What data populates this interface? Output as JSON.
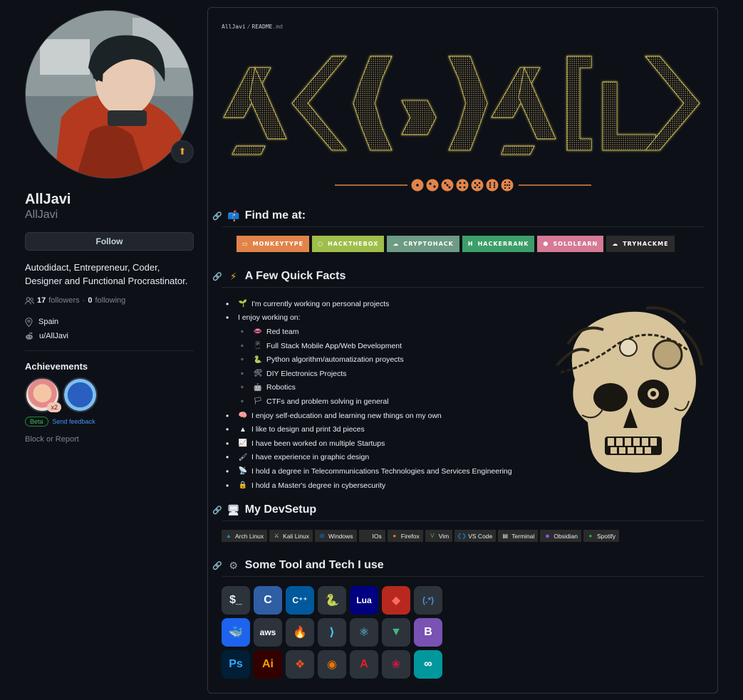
{
  "profile": {
    "fullname": "AllJavi",
    "username": "AllJavi",
    "follow_label": "Follow",
    "bio": "Autodidact, Entrepreneur, Coder, Designer and Functional Procrastinator.",
    "followers_count": "17",
    "followers_label": "followers",
    "dot": "·",
    "following_count": "0",
    "following_label": "following",
    "location": "Spain",
    "reddit": "u/AllJavi",
    "achievements_title": "Achievements",
    "badge_count": "x2",
    "beta_label": "Beta",
    "feedback_label": "Send feedback",
    "report_label": "Block or Report"
  },
  "readme": {
    "breadcrumb_user": "AllJavi",
    "breadcrumb_sep": "/",
    "breadcrumb_file": "README",
    "breadcrumb_ext": ".md",
    "find_title": "Find me at:",
    "facts_title": "A Few Quick Facts",
    "devsetup_title": "My DevSetup",
    "tools_title": "Some Tool and Tech I use"
  },
  "social": [
    {
      "label": "MONKEYTYPE",
      "color": "#e2844a",
      "icon": "▭"
    },
    {
      "label": "HACKTHEBOX",
      "color": "#9fbe4a",
      "icon": "⬡"
    },
    {
      "label": "CRYPTOHACK",
      "color": "#6d9b84",
      "icon": "☁"
    },
    {
      "label": "HACKERRANK",
      "color": "#3d9e6a",
      "icon": "H"
    },
    {
      "label": "SOLOLEARN",
      "color": "#d67a95",
      "icon": "⬢"
    },
    {
      "label": "TRYHACKME",
      "color": "#2b2b2b",
      "icon": "☁"
    }
  ],
  "facts": [
    {
      "level": 1,
      "icon": "🌱",
      "text": "I'm currently working on personal projects"
    },
    {
      "level": 1,
      "icon": "",
      "text": "I enjoy working on:"
    },
    {
      "level": 2,
      "icon": "👄",
      "text": "Red team"
    },
    {
      "level": 2,
      "icon": "📱",
      "text": "Full Stack Mobile App/Web Development"
    },
    {
      "level": 2,
      "icon": "🐍",
      "text": "Python algorithm/automatization proyects"
    },
    {
      "level": 2,
      "icon": "🛠",
      "text": "DIY Electronics Projects"
    },
    {
      "level": 2,
      "icon": "🤖",
      "text": "Robotics"
    },
    {
      "level": 2,
      "icon": "🏳",
      "text": "CTFs and problem solving in general"
    },
    {
      "level": 1,
      "icon": "🧠",
      "text": "I enjoy self-education and learning new things on my own"
    },
    {
      "level": 1,
      "icon": "▲",
      "text": "I like to design and print 3d pieces"
    },
    {
      "level": 1,
      "icon": "📈",
      "text": "I have been worked on multiple Startups"
    },
    {
      "level": 1,
      "icon": "🖌",
      "text": "I have experience in graphic design"
    },
    {
      "level": 1,
      "icon": "📡",
      "text": "I hold a degree in Telecommunications Technologies and Services Engineering"
    },
    {
      "level": 1,
      "icon": "🔒",
      "text": "I hold a Master's degree in cybersecurity"
    }
  ],
  "devsetup": [
    {
      "label": "Arch Linux",
      "icon": "▲",
      "color": "#1793d1"
    },
    {
      "label": "Kali Linux",
      "icon": "⚔",
      "color": "#cfcfcf"
    },
    {
      "label": "Windows",
      "icon": "⊞",
      "color": "#0078d6"
    },
    {
      "label": "IOs",
      "icon": "",
      "color": "#ffffff"
    },
    {
      "label": "Firefox",
      "icon": "●",
      "color": "#ff7139"
    },
    {
      "label": "Vim",
      "icon": "V",
      "color": "#37b34a"
    },
    {
      "label": "VS Code",
      "icon": "❮❯",
      "color": "#0078d4"
    },
    {
      "label": "Terminal",
      "icon": "▤",
      "color": "#e6edf3"
    },
    {
      "label": "Obsidian",
      "icon": "◆",
      "color": "#7c5bd9"
    },
    {
      "label": "Spotify",
      "icon": "●",
      "color": "#1db954"
    }
  ],
  "tools": [
    {
      "name": "bash-icon",
      "glyph": "$_",
      "bg": "#2d333b",
      "fg": "#e6edf3"
    },
    {
      "name": "c-icon",
      "glyph": "C",
      "bg": "#2f5ea3",
      "fg": "#ffffff"
    },
    {
      "name": "cpp-icon",
      "glyph": "C⁺⁺",
      "bg": "#00599c",
      "fg": "#ffffff"
    },
    {
      "name": "python-icon",
      "glyph": "🐍",
      "bg": "#2d333b",
      "fg": "#ffd43b"
    },
    {
      "name": "lua-icon",
      "glyph": "Lua",
      "bg": "#000080",
      "fg": "#ffffff"
    },
    {
      "name": "ruby-icon",
      "glyph": "◆",
      "bg": "#b8281e",
      "fg": "#ff6b5b"
    },
    {
      "name": "regex-icon",
      "glyph": "(.*)",
      "bg": "#2d333b",
      "fg": "#4a90d9"
    },
    {
      "name": "docker-icon",
      "glyph": "🐳",
      "bg": "#1d63ed",
      "fg": "#ffffff"
    },
    {
      "name": "aws-icon",
      "glyph": "aws",
      "bg": "#2d333b",
      "fg": "#ffffff"
    },
    {
      "name": "firebase-icon",
      "glyph": "🔥",
      "bg": "#2d333b",
      "fg": "#ffca28"
    },
    {
      "name": "flutter-icon",
      "glyph": "⟩",
      "bg": "#2d333b",
      "fg": "#44d1fd"
    },
    {
      "name": "react-icon",
      "glyph": "⚛",
      "bg": "#2d333b",
      "fg": "#61dafb"
    },
    {
      "name": "vue-icon",
      "glyph": "▼",
      "bg": "#2d333b",
      "fg": "#41b883"
    },
    {
      "name": "bootstrap-icon",
      "glyph": "B",
      "bg": "#7952b3",
      "fg": "#ffffff"
    },
    {
      "name": "photoshop-icon",
      "glyph": "Ps",
      "bg": "#001e36",
      "fg": "#31a8ff"
    },
    {
      "name": "illustrator-icon",
      "glyph": "Ai",
      "bg": "#330000",
      "fg": "#ff9a00"
    },
    {
      "name": "figma-icon",
      "glyph": "❖",
      "bg": "#2d333b",
      "fg": "#f24e1e"
    },
    {
      "name": "blender-icon",
      "glyph": "◉",
      "bg": "#2d333b",
      "fg": "#ea7600"
    },
    {
      "name": "acrobat-icon",
      "glyph": "A",
      "bg": "#2d333b",
      "fg": "#ec1c24"
    },
    {
      "name": "raspberrypi-icon",
      "glyph": "❀",
      "bg": "#2d333b",
      "fg": "#c51a4a"
    },
    {
      "name": "arduino-icon",
      "glyph": "∞",
      "bg": "#00979d",
      "fg": "#ffffff"
    }
  ],
  "colors": {
    "bg": "#0d1117",
    "border": "#30363d",
    "text": "#e6edf3",
    "muted": "#7d8590",
    "link": "#4493f8",
    "accent_orange": "#e2844a"
  }
}
